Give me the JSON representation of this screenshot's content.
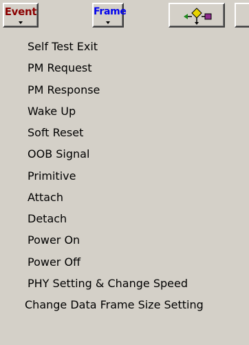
{
  "toolbar": {
    "event_button": {
      "label": "Event",
      "color": "#8b0000"
    },
    "frame_button": {
      "label": "Frame",
      "color": "#0000ee"
    },
    "flow_button": {
      "icon": "diagram-flow-icon"
    }
  },
  "menu": {
    "items": [
      {
        "label": "Self Test Exit"
      },
      {
        "label": "PM Request"
      },
      {
        "label": "PM Response"
      },
      {
        "label": "Wake Up"
      },
      {
        "label": "Soft Reset"
      },
      {
        "label": "OOB Signal"
      },
      {
        "label": "Primitive"
      },
      {
        "label": "Attach"
      },
      {
        "label": "Detach"
      },
      {
        "label": "Power On"
      },
      {
        "label": "Power Off"
      },
      {
        "label": "PHY Setting & Change Speed"
      },
      {
        "label": "Change Data Frame Size Setting"
      }
    ]
  }
}
